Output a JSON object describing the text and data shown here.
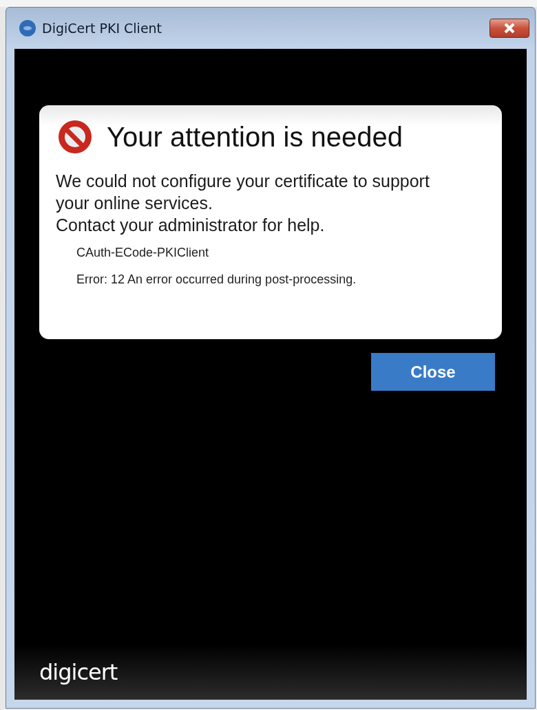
{
  "window": {
    "title": "DigiCert PKI Client"
  },
  "alert": {
    "title": "Your attention is needed",
    "message": [
      "We could not configure your certificate to support your online services.",
      "Contact your administrator for help."
    ],
    "details": [
      "CAuth-ECode-PKIClient",
      "Error: 12 An error occurred during post-processing."
    ]
  },
  "buttons": [
    "Close"
  ],
  "footer": {
    "logo": "digicert"
  }
}
